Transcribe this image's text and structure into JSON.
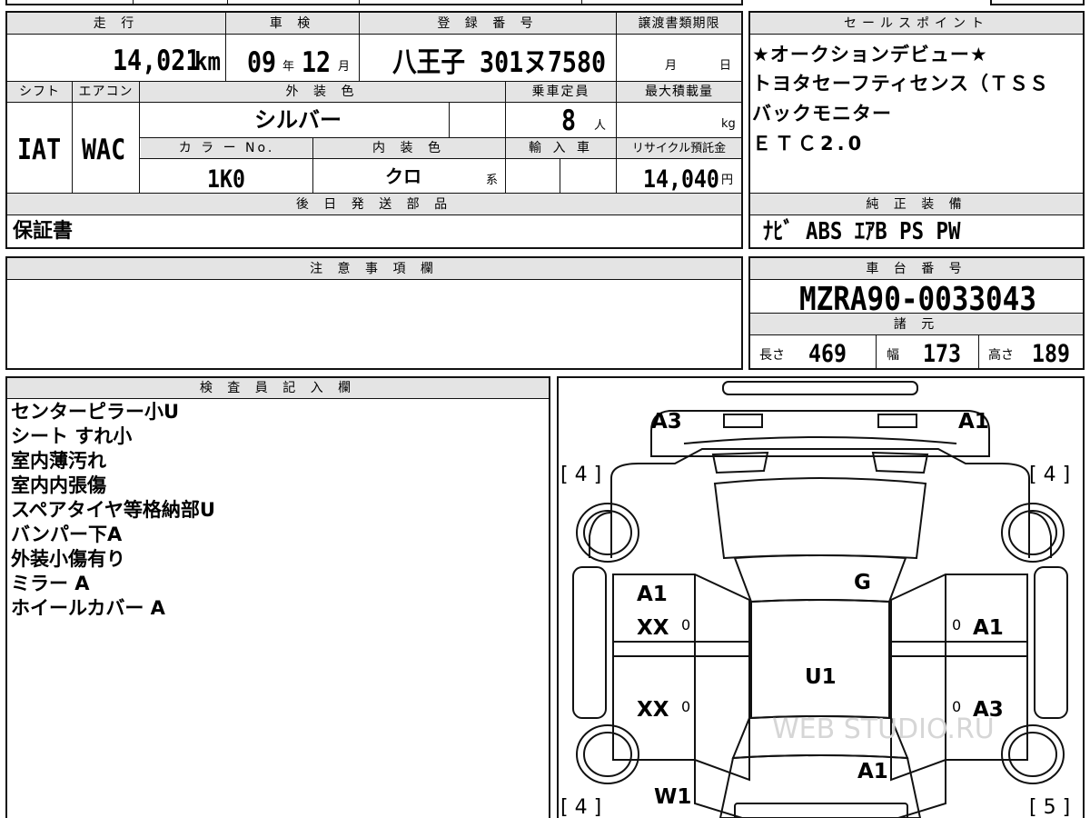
{
  "vehicle": {
    "mileage_label": "走 行",
    "mileage_value": "14,021",
    "mileage_unit": "km",
    "inspection_label": "車 検",
    "inspection_year": "09",
    "inspection_year_unit": "年",
    "inspection_month": "12",
    "inspection_month_unit": "月",
    "registration_label": "登 録 番 号",
    "registration_value": "八王子 301ヌ7580",
    "transfer_deadline_label": "譲渡書類期限",
    "transfer_month_unit": "月",
    "transfer_day_unit": "日",
    "shift_label": "シフト",
    "shift_value": "IAT",
    "aircon_label": "エアコン",
    "aircon_value": "WAC",
    "exterior_color_label": "外 装 色",
    "exterior_color_value": "シルバー",
    "capacity_label": "乗車定員",
    "capacity_value": "8",
    "capacity_unit": "人",
    "max_load_label": "最大積載量",
    "max_load_unit": "kg",
    "color_no_label": "カ ラ ー No.",
    "color_no_value": "1K0",
    "interior_color_label": "内 装 色",
    "interior_color_value": "クロ",
    "interior_color_unit": "系",
    "import_label": "輸 入 車",
    "recycle_label": "リサイクル預託金",
    "recycle_value": "14,040",
    "recycle_unit": "円",
    "later_parts_label": "後 日 発 送 部 品",
    "later_parts_value": "保証書"
  },
  "sales_points": {
    "label": "セールスポイント",
    "lines": [
      "★オークションデビュー★",
      "トヨタセーフティセンス（ＴＳＳ",
      "バックモニター",
      "ＥＴＣ2.0"
    ]
  },
  "equipment": {
    "label": "純 正 装 備",
    "value": "ﾅﾋﾞ  ABS  ｴｱB  PS  PW"
  },
  "notes": {
    "label": "注 意 事 項 欄"
  },
  "chassis": {
    "label": "車 台 番 号",
    "value": "MZRA90-0033043"
  },
  "specs": {
    "label": "諸 元",
    "length_label": "長さ",
    "length_value": "469",
    "width_label": "幅",
    "width_value": "173",
    "height_label": "高さ",
    "height_value": "189"
  },
  "inspector": {
    "label": "検 査 員 記 入 欄",
    "lines": [
      "センターピラー小U",
      "シート すれ小",
      "室内薄汚れ",
      "室内内張傷",
      "スペアタイヤ等格納部U",
      "バンパー下A",
      "外装小傷有り",
      "ミラー A",
      "ホイールカバー A"
    ]
  },
  "diagram": {
    "a3_top_left": "A3",
    "a1_top_right": "A1",
    "tire_top_left": "[ 4 ]",
    "tire_top_right": "[ 4 ]",
    "g_windshield": "G",
    "a1_left_front_door": "A1",
    "xx_left_front_door": "XX",
    "a1_right_front_door": "A1",
    "u1_roof": "U1",
    "xx_left_rear_door": "XX",
    "a3_right_rear_door": "A3",
    "a1_rear": "A1",
    "w1_rear_left": "W1",
    "tire_bottom_left": "[ 4 ]",
    "tire_bottom_right": "[ 5 ]",
    "zero_mark": "0",
    "watermark": "WEB STUDIO.RU"
  }
}
